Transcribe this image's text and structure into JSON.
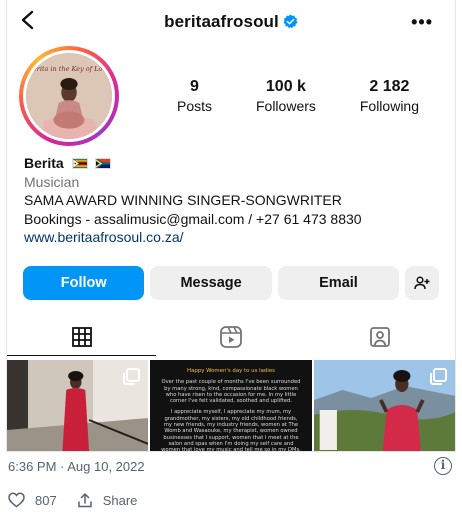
{
  "profile": {
    "username": "beritaafrosoul",
    "name": "Berita",
    "category": "Musician",
    "bio_line1": "SAMA AWARD WINNING SINGER-SONGWRITER",
    "bio_line2": "Bookings - assalimusic@gmail.com / +27 61 473 8830",
    "website": "www.beritaafrosoul.co.za/",
    "avatar_caption": "Berita in the Key of Love"
  },
  "stats": [
    {
      "value": "9",
      "label": "Posts"
    },
    {
      "value": "100 k",
      "label": "Followers"
    },
    {
      "value": "2 182",
      "label": "Following"
    }
  ],
  "buttons": {
    "follow": "Follow",
    "message": "Message",
    "email": "Email"
  },
  "tabs": [
    {
      "icon": "grid-icon",
      "active": true
    },
    {
      "icon": "reels-icon",
      "active": false
    },
    {
      "icon": "tagged-icon",
      "active": false
    }
  ],
  "posts": {
    "post2_title": "Happy Women's day to us ladies",
    "post2_p1": "Over the past couple of months I've been surrounded by many strong, kind, compassionate black women who have risen to the occasion for me. In my little corner I've felt validated, soothed and uplifted.",
    "post2_p2": "I appreciate myself, I appreciate my mum, my grandmother, my sisters, my old childhood friends, my new friends, my industry friends, women at The Womb and Wasaouke, my therapist, women owned businesses that I support, women that I meet at the salon and spas when I'm doing my self care and women that love my music and tell me so in my DMs."
  },
  "tweet": {
    "timestamp": "6:36 PM · Aug 10, 2022",
    "likes": "807",
    "share_label": "Share"
  },
  "colors": {
    "follow_blue": "#0095f6",
    "verified_blue": "#0095f6",
    "link_blue": "#00376b"
  }
}
